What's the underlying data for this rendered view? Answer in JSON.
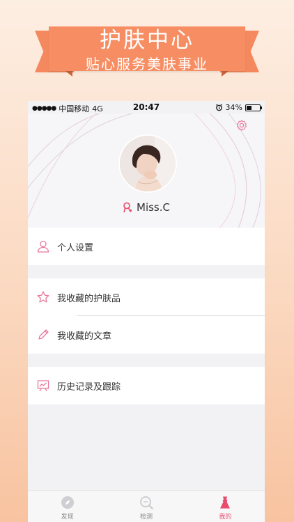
{
  "banner": {
    "title": "护肤中心",
    "subtitle": "贴心服务美肤事业"
  },
  "status_bar": {
    "signal_dots": "●●●●●",
    "carrier": "中国移动",
    "network": "4G",
    "time": "20:47",
    "battery": "34%"
  },
  "profile": {
    "username": "Miss.C"
  },
  "menu": {
    "settings": "个人设置",
    "fav_products": "我收藏的护肤品",
    "fav_articles": "我收藏的文章",
    "history": "历史记录及跟踪"
  },
  "tabs": [
    {
      "label": "发现",
      "icon": "compass-icon",
      "active": false
    },
    {
      "label": "检测",
      "icon": "magnifier-icon",
      "active": false
    },
    {
      "label": "我的",
      "icon": "dress-icon",
      "active": true
    }
  ],
  "colors": {
    "accent": "#e84b6d",
    "banner": "#f78e63",
    "icon_pink": "#e8799a"
  }
}
